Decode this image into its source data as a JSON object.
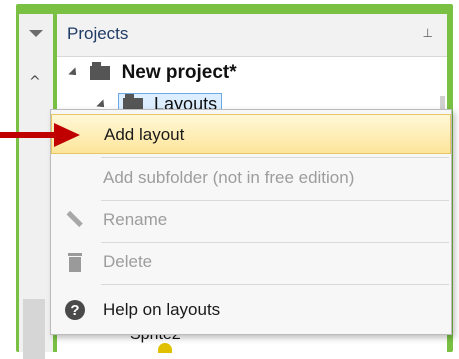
{
  "panel": {
    "title": "Projects",
    "pin_icon": "pin-icon",
    "glyph_pin": "⊥"
  },
  "tree": {
    "project_label": "New project*",
    "layouts_label": "Layouts",
    "bottom_label": "Sprite2"
  },
  "context_menu": {
    "items": [
      {
        "label": "Add layout",
        "enabled": true,
        "highlighted": true,
        "icon": ""
      },
      {
        "label": "Add subfolder (not in free edition)",
        "enabled": false,
        "highlighted": false,
        "icon": ""
      },
      {
        "label": "Rename",
        "enabled": false,
        "highlighted": false,
        "icon": "pencil-icon"
      },
      {
        "label": "Delete",
        "enabled": false,
        "highlighted": false,
        "icon": "trash-icon"
      },
      {
        "label": "Help on layouts",
        "enabled": true,
        "highlighted": false,
        "icon": "help-icon",
        "glyph": "?"
      }
    ]
  },
  "colors": {
    "frame_green": "#7ac143",
    "highlight": "#fde59a",
    "arrow_red": "#c00000"
  }
}
